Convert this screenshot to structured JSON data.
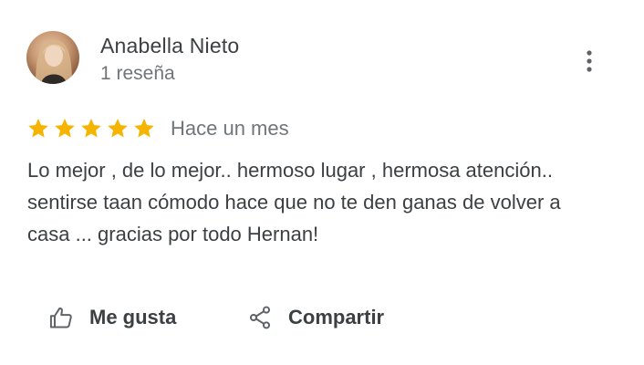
{
  "review": {
    "author_name": "Anabella Nieto",
    "author_meta": "1 reseña",
    "rating": 5,
    "rating_max": 5,
    "date": "Hace un mes",
    "text": "Lo mejor , de lo mejor.. hermoso lugar , hermosa atención.. sentirse taan cómodo hace que no te den ganas de volver a casa ... gracias por todo Hernan!"
  },
  "actions": {
    "like_label": "Me gusta",
    "share_label": "Compartir"
  },
  "icons": {
    "more": "more-vert-icon",
    "like": "thumb-up-icon",
    "share": "share-icon",
    "star": "star-icon"
  },
  "colors": {
    "star": "#f4b400",
    "text": "#3c4043",
    "secondary_text": "#70757a"
  }
}
